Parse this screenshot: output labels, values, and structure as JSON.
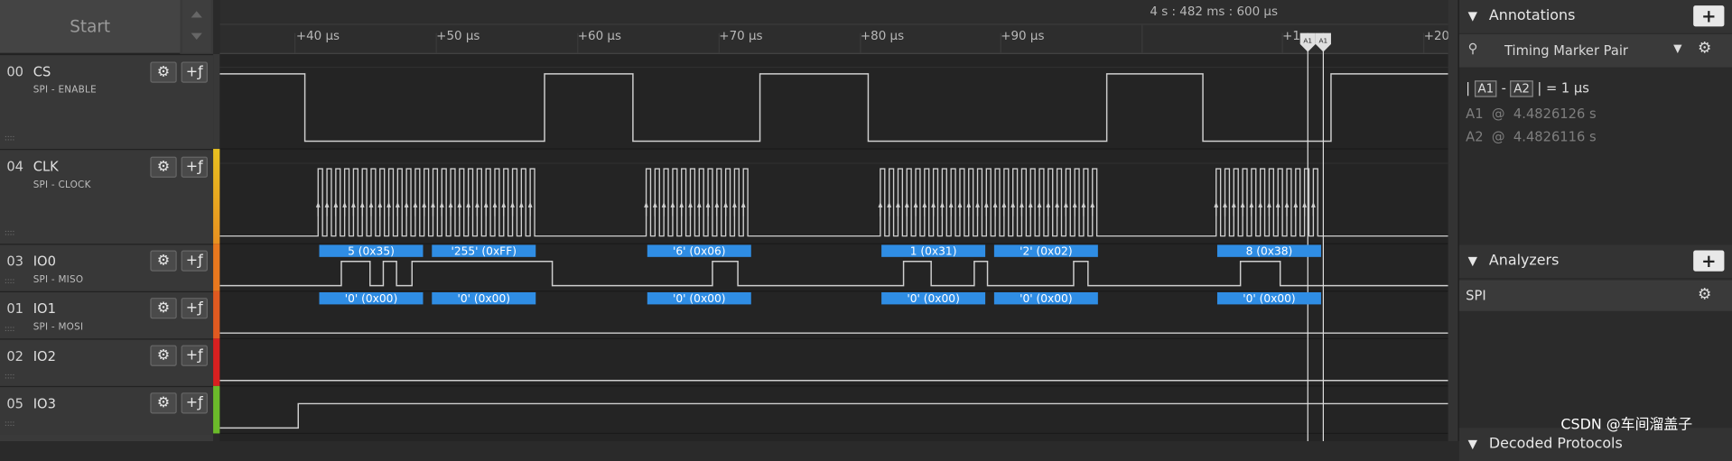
{
  "header": {
    "start_label": "Start",
    "time_readout": "4 s : 482 ms : 600 µs"
  },
  "ruler": {
    "ticks": [
      "+40 µs",
      "+50 µs",
      "+60 µs",
      "+70 µs",
      "+80 µs",
      "+90 µs",
      "+1",
      "+20"
    ],
    "markers": [
      "A1",
      "A1"
    ]
  },
  "channels": [
    {
      "num": "00",
      "name": "CS",
      "sub": "SPI - ENABLE",
      "color": "#383838"
    },
    {
      "num": "04",
      "name": "CLK",
      "sub": "SPI - CLOCK",
      "color": "#f0a020"
    },
    {
      "num": "03",
      "name": "IO0",
      "sub": "SPI - MISO",
      "color": "#e8781e"
    },
    {
      "num": "01",
      "name": "IO1",
      "sub": "SPI - MOSI",
      "color": "#e05a20"
    },
    {
      "num": "02",
      "name": "IO2",
      "sub": "",
      "color": "#d82020"
    },
    {
      "num": "05",
      "name": "IO3",
      "sub": "",
      "color": "#6bbb2a"
    }
  ],
  "miso_decodes": [
    "5 (0x35)",
    "'255' (0xFF)",
    "'6' (0x06)",
    "1 (0x31)",
    "'2' (0x02)",
    "8 (0x38)"
  ],
  "mosi_decodes": [
    "'0' (0x00)",
    "'0' (0x00)",
    "'0' (0x00)",
    "'0' (0x00)",
    "'0' (0x00)",
    "'0' (0x00)"
  ],
  "annotations": {
    "title": "Annotations",
    "add_label": "+",
    "item": "Timing Marker Pair",
    "delta_a": "A1",
    "delta_b": "A2",
    "delta_value": "= 1 µs",
    "a1_label": "A1",
    "a1_at": "@",
    "a1_value": "4.4826126 s",
    "a2_label": "A2",
    "a2_at": "@",
    "a2_value": "4.4826116 s"
  },
  "analyzers": {
    "title": "Analyzers",
    "add_label": "+",
    "items": [
      "SPI"
    ]
  },
  "decoded": {
    "title": "Decoded Protocols"
  },
  "watermark": "CSDN @车间溜盖子",
  "colors": {
    "decode_box": "#2f8de4",
    "wave": "#cfcfcf"
  }
}
